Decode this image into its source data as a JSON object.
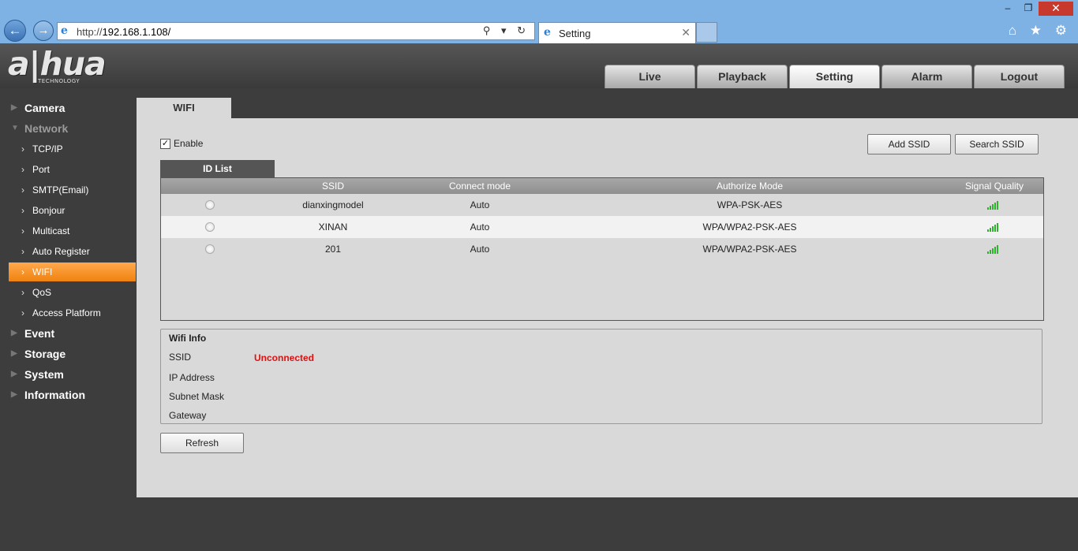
{
  "browser": {
    "url_prefix": "http://",
    "url_host": "192.168.1.108/",
    "tab_title": "Setting",
    "back_glyph": "←",
    "forward_glyph": "→",
    "addr_tools": "⚲ ▾ ↻",
    "tab_close": "✕",
    "win_min": "–",
    "win_max": "❐",
    "win_close": "✕",
    "toolbar_icons": "⌂ ★ ⚙"
  },
  "logo": {
    "main": "a|hua",
    "sub": "TECHNOLOGY"
  },
  "top_tabs": [
    {
      "label": "Live"
    },
    {
      "label": "Playback"
    },
    {
      "label": "Setting"
    },
    {
      "label": "Alarm"
    },
    {
      "label": "Logout"
    }
  ],
  "sidebar": {
    "camera": "Camera",
    "network": "Network",
    "network_items": [
      "TCP/IP",
      "Port",
      "SMTP(Email)",
      "Bonjour",
      "Multicast",
      "Auto Register",
      "WIFI",
      "QoS",
      "Access Platform"
    ],
    "event": "Event",
    "storage": "Storage",
    "system": "System",
    "information": "Information"
  },
  "content": {
    "tab": "WIFI",
    "enable_label": "Enable",
    "enable_checked": true,
    "add_ssid": "Add SSID",
    "search_ssid": "Search SSID",
    "list_tab": "ID List",
    "columns": [
      "SSID",
      "Connect mode",
      "Authorize Mode",
      "Signal Quality"
    ],
    "rows": [
      {
        "ssid": "dianxingmodel",
        "mode": "Auto",
        "auth": "WPA-PSK-AES",
        "signal_bars": 5
      },
      {
        "ssid": "XINAN",
        "mode": "Auto",
        "auth": "WPA/WPA2-PSK-AES",
        "signal_bars": 5
      },
      {
        "ssid": "201",
        "mode": "Auto",
        "auth": "WPA/WPA2-PSK-AES",
        "signal_bars": 5
      }
    ],
    "info": {
      "title": "Wifi Info",
      "ssid_label": "SSID",
      "ssid_value": "Unconnected",
      "ip_label": "IP Address",
      "subnet_label": "Subnet Mask",
      "gateway_label": "Gateway"
    },
    "refresh": "Refresh"
  },
  "colors": {
    "accent": "#f0820f",
    "signal": "#2bb52b",
    "status_error": "#e01010"
  }
}
